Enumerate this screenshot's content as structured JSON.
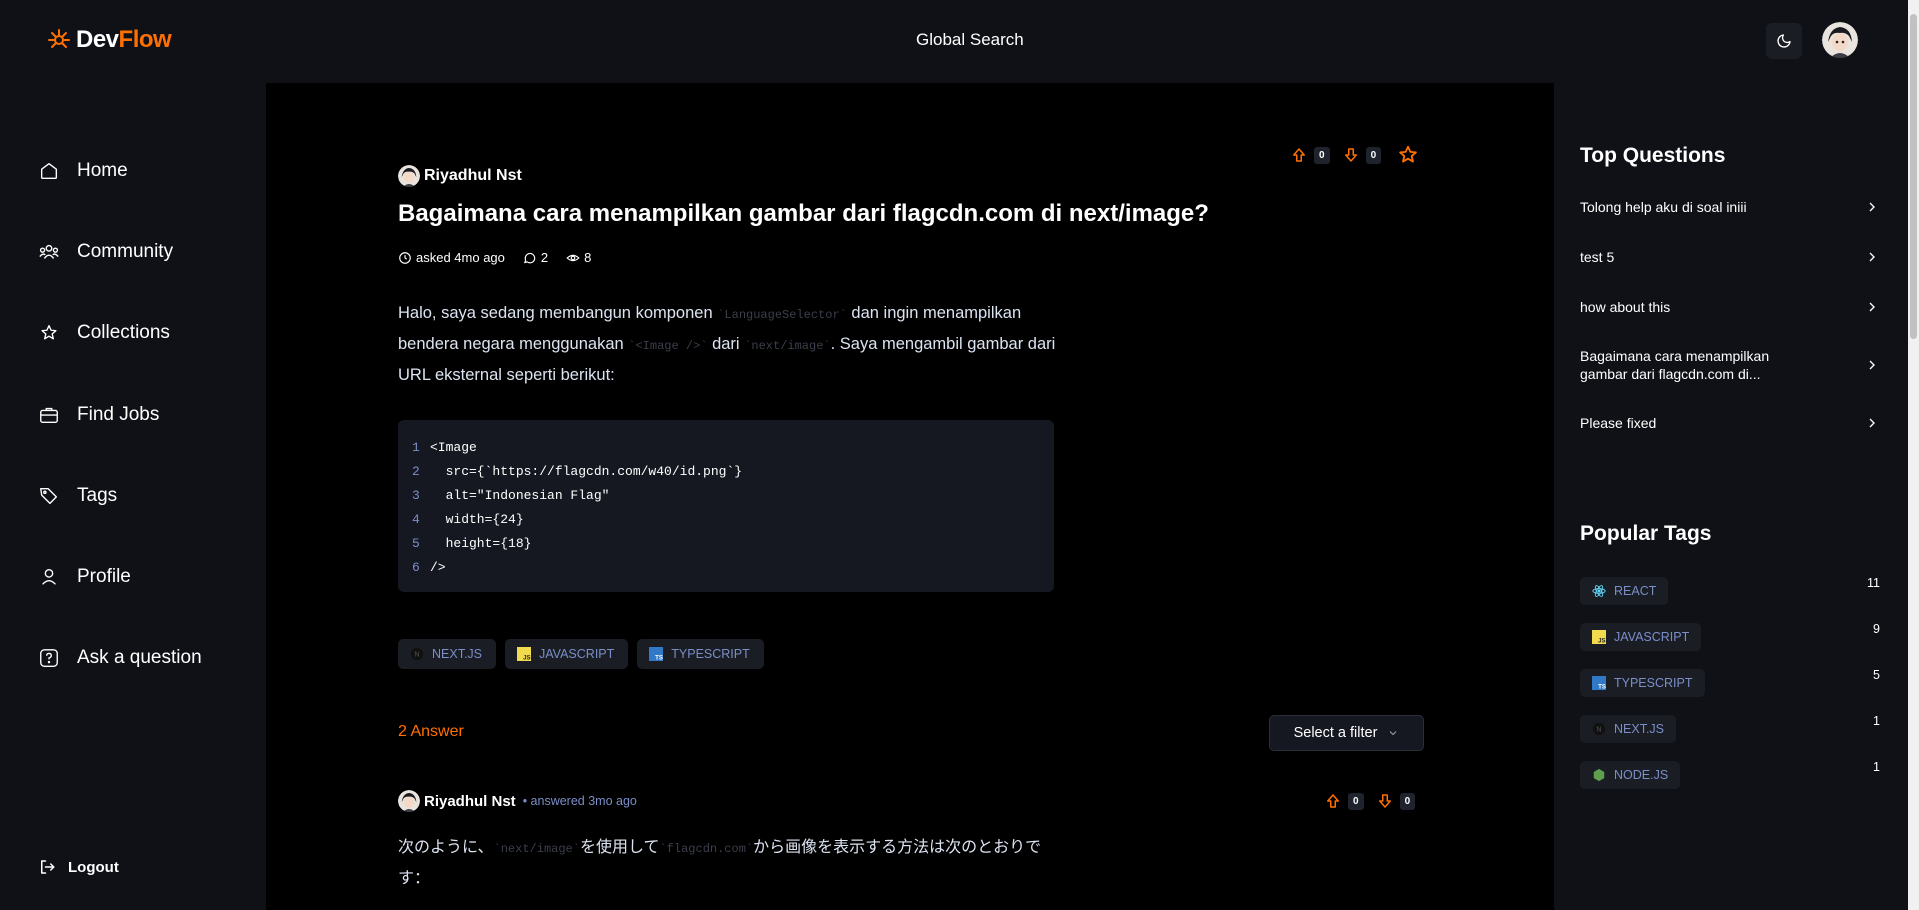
{
  "navbar": {
    "logo_dev": "Dev",
    "logo_flow": "Flow",
    "global_search": "Global Search"
  },
  "sidebar": {
    "items": [
      {
        "label": "Home",
        "icon": "home-icon"
      },
      {
        "label": "Community",
        "icon": "users-icon"
      },
      {
        "label": "Collections",
        "icon": "star-icon"
      },
      {
        "label": "Find Jobs",
        "icon": "briefcase-icon"
      },
      {
        "label": "Tags",
        "icon": "tag-icon"
      },
      {
        "label": "Profile",
        "icon": "user-icon"
      },
      {
        "label": "Ask a question",
        "icon": "question-icon"
      }
    ],
    "logout": "Logout"
  },
  "question": {
    "author": "Riyadhul Nst",
    "upvotes": "0",
    "downvotes": "0",
    "title": "Bagaimana cara menampilkan gambar dari flagcdn.com di next/image?",
    "asked": "asked 4mo ago",
    "answers": "2",
    "views": "8",
    "body": {
      "p1": "Halo, saya sedang membangun komponen ",
      "c1": "`LanguageSelector`",
      "p2": " dan ingin menampilkan bendera negara menggunakan ",
      "c2": "`<Image />`",
      "p3": " dari ",
      "c3": "`next/image`",
      "p4": ". Saya mengambil gambar dari URL eksternal seperti berikut:"
    },
    "code": [
      {
        "n": "1",
        "t": "<Image"
      },
      {
        "n": "2",
        "t": "  src={`https://flagcdn.com/w40/id.png`}"
      },
      {
        "n": "3",
        "t": "  alt=\"Indonesian Flag\""
      },
      {
        "n": "4",
        "t": "  width={24}"
      },
      {
        "n": "5",
        "t": "  height={18}"
      },
      {
        "n": "6",
        "t": "/>"
      }
    ],
    "tags": [
      "NEXT.JS",
      "JAVASCRIPT",
      "TYPESCRIPT"
    ]
  },
  "answers_section": {
    "count_label": "2 Answer",
    "filter_placeholder": "Select a filter"
  },
  "answer": {
    "author": "Riyadhul Nst",
    "meta": "• answered 3mo ago",
    "upvotes": "0",
    "downvotes": "0",
    "body": {
      "p1": "次のように、",
      "c1": "`next/image`",
      "p2": "を使用して",
      "c2": "`flagcdn.com`",
      "p3": "から画像を表示する方法は次のとおりです："
    }
  },
  "right_sidebar": {
    "top_questions_heading": "Top Questions",
    "top_questions": [
      "Tolong help aku di soal iniii",
      "test 5",
      "how about this",
      "Bagaimana cara menampilkan gambar dari flagcdn.com di...",
      "Please fixed"
    ],
    "popular_tags_heading": "Popular Tags",
    "popular_tags": [
      {
        "name": "REACT",
        "count": "11"
      },
      {
        "name": "JAVASCRIPT",
        "count": "9"
      },
      {
        "name": "TYPESCRIPT",
        "count": "5"
      },
      {
        "name": "NEXT.JS",
        "count": "1"
      },
      {
        "name": "NODE.JS",
        "count": "1"
      }
    ]
  },
  "colors": {
    "accent": "#ff7000",
    "tag_text": "#7b8ec8",
    "panel": "#0f1117"
  }
}
